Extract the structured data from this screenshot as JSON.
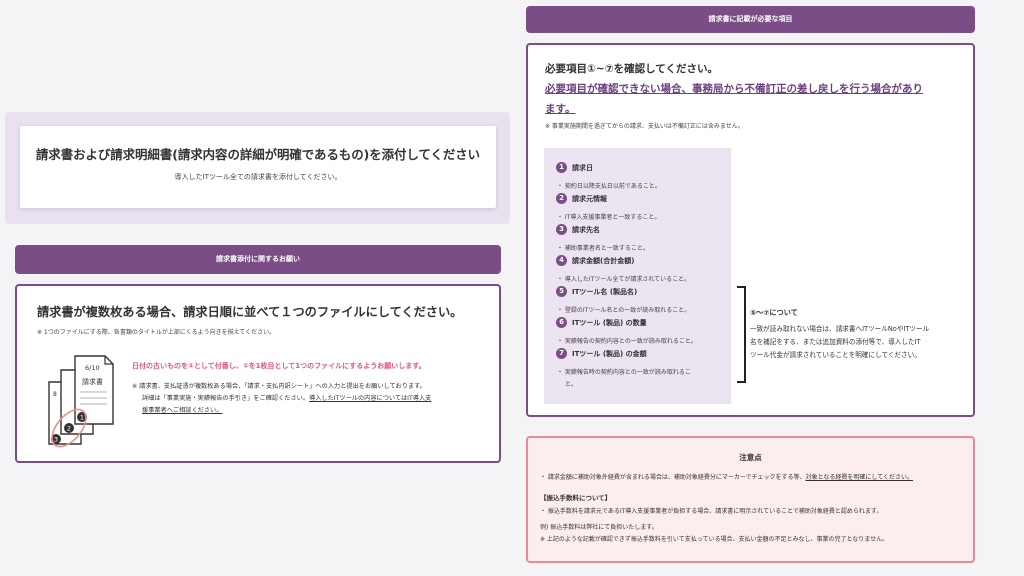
{
  "attach_card": {
    "title": "請求書および請求明細書(請求内容の詳細が明確であるもの)を添付してください",
    "subtitle": "導入したITツール全ての請求書を添付してください。"
  },
  "request_section": {
    "header": "請求書添付に関するお願い",
    "title": "請求書が複数枚ある場合、請求日順に並べて１つのファイルにしてください。",
    "note": "※ 1つのファイルにする際、各書類のタイトルが上部にくるよう向きを揃えてください。",
    "emphasis": "日付の古いものを①として付番し、①を1枚目として1つのファイルにするようお願いします。",
    "para_line1": "※ 請求書、支払証憑が複数枚ある場合、「請求・支払内訳シート」への入力と提出をお願いしております。",
    "para_line2_a": "詳細は「事業実施・実績報告の手引き」をご確認ください。",
    "para_line2_b": "導入したITツールの内容についてはIT導入支",
    "para_line3": "援事業者へご相談ください。",
    "illustration": {
      "page_number": "6/10",
      "doc_title": "請求書",
      "badges": [
        "1",
        "2",
        "3"
      ],
      "back_number": "8"
    }
  },
  "required_items": {
    "header": "請求書に記載が必要な項目",
    "line1": "必要項目①~⑦を確認してください。",
    "line2": "必要項目が確認できない場合、事務局から不備訂正の差し戻しを行う場合があり",
    "line3": "ます。",
    "note": "※ 事業実施期間を過ぎてからの請求、支払いは不備訂正には含みません。",
    "items": [
      {
        "num": "1",
        "title": "請求日",
        "desc": "・ 契約日以降支払日以前であること。",
        "desc2": ""
      },
      {
        "num": "2",
        "title": "請求元情報",
        "desc": "・ IT導入支援事業者と一致すること。",
        "desc2": ""
      },
      {
        "num": "3",
        "title": "請求先名",
        "desc": "・ 補助事業者名と一致すること。",
        "desc2": ""
      },
      {
        "num": "4",
        "title": "請求金額(合計金額)",
        "desc": "・ 導入したITツール全てが請求されていること。",
        "desc2": ""
      },
      {
        "num": "5",
        "title": "ITツール名 (製品名)",
        "desc": "・ 登録のITツール名との一致が読み取れること。",
        "desc2": ""
      },
      {
        "num": "6",
        "title": "ITツール (製品) の数量",
        "desc": "・ 実績報告の契約内容との一致が読み取れること。",
        "desc2": ""
      },
      {
        "num": "7",
        "title": "ITツール (製品) の金額",
        "desc": "・ 実績報告時の契約内容との一致が読み取れるこ",
        "desc2": "と。"
      }
    ],
    "side_note": {
      "heading": "⑤～⑦について",
      "lines": [
        "一致が読み取れない場合は、請求書へITツールNoやITツール",
        "名を補記をする、または追加資料の添付等で、導入したIT",
        "ツール代金が請求されていることを明確にしてください。"
      ]
    }
  },
  "caution": {
    "title": "注意点",
    "line1_a": "・ 請求金額に補助対象外経費が含まれる場合は、補助対象経費分にマーカーでチェックをする等、",
    "line1_b": "対象となる経費を明確にしてください。",
    "fee_heading": "【振込手数料について】",
    "fee_line": "・ 振込手数料を請求元であるIT導入支援事業者が負担する場合、請求書に明示されていることで補助対象経費と認められます。",
    "example": "例) 振込手数料は弊社にて負担いたします。",
    "warning": "※ 上記のような記載が確認できず振込手数料を引いて支払っている場合、支払い金額の不足とみなし、事業の完了となりません。"
  },
  "colors": {
    "purple": "#7a4d86",
    "lavender": "#e9e1ef",
    "pink_text": "#e0577a",
    "caution_border": "#e88a97",
    "caution_bg": "#fdeeee"
  }
}
